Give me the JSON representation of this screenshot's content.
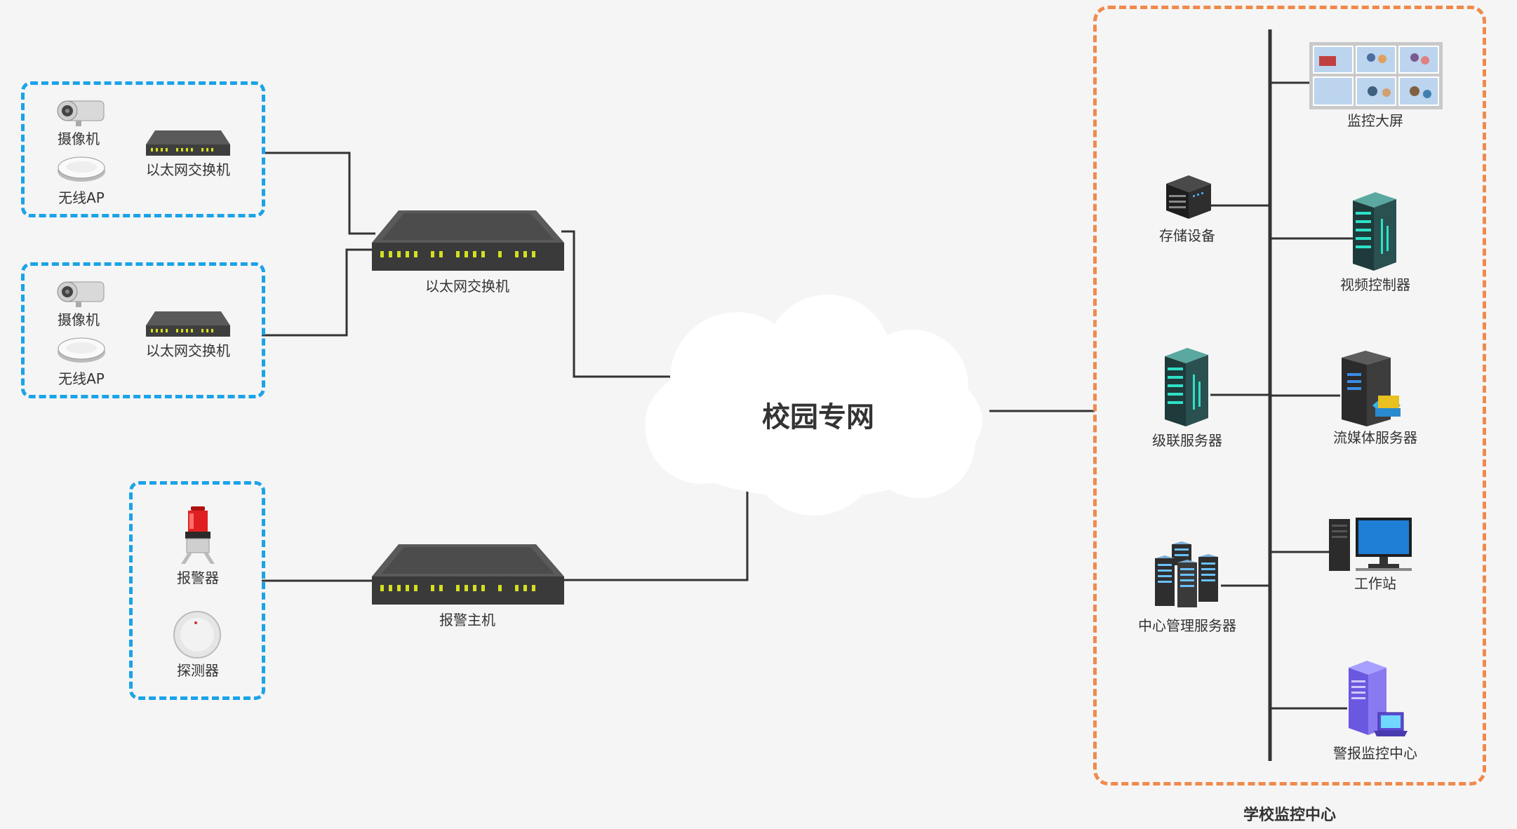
{
  "network": {
    "name": "校园专网"
  },
  "groups": [
    {
      "camera": "摄像机",
      "ap": "无线AP",
      "switch": "以太网交换机"
    },
    {
      "camera": "摄像机",
      "ap": "无线AP",
      "switch": "以太网交换机"
    },
    {
      "alarm": "报警器",
      "detector": "探测器"
    }
  ],
  "core_switch": "以太网交换机",
  "alarm_host": "报警主机",
  "center": {
    "title": "学校监控中心",
    "devices": {
      "screen": "监控大屏",
      "storage": "存储设备",
      "video_ctrl": "视频控制器",
      "cascade": "级联服务器",
      "stream": "流媒体服务器",
      "workstation": "工作站",
      "mgmt": "中心管理服务器",
      "alarm_center": "警报监控中心"
    }
  }
}
